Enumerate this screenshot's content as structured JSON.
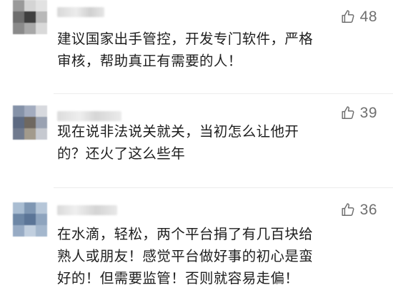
{
  "comments": [
    {
      "likes": "48",
      "lines": [
        "建议国家出手管控，开发专门软件，严格",
        "审核，帮助真正有需要的人！"
      ]
    },
    {
      "likes": "39",
      "lines": [
        "现在说非法说关就关，当初怎么让他开",
        "的？还火了这么些年"
      ]
    },
    {
      "likes": "36",
      "lines": [
        "在水滴，轻松，两个平台捐了有几百块给",
        "熟人或朋友！感觉平台做好事的初心是蛮",
        "好的！但需要监管！否则就容易走偏！"
      ]
    }
  ],
  "icons": {
    "like": "thumbs-up-icon"
  },
  "colors": {
    "background": "#ffffff",
    "text": "#1e1e1e",
    "like": "#6f6f6f"
  }
}
